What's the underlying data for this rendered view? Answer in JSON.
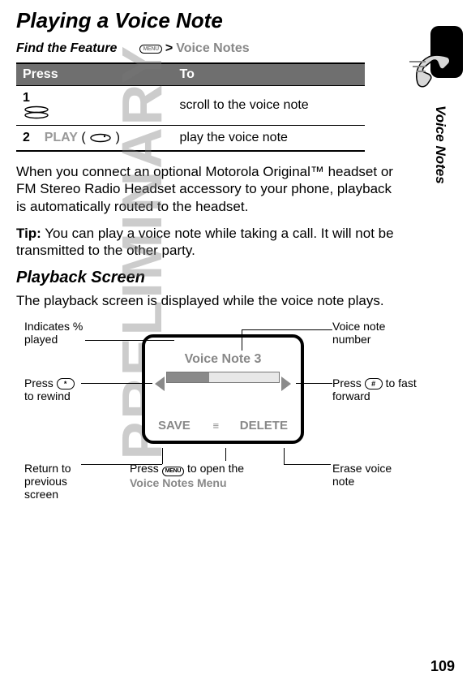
{
  "title": "Playing a Voice Note",
  "find_feature_label": "Find the Feature",
  "menu_key_label": "MENU",
  "nav_path": "Voice Notes",
  "side_tab": "Voice Notes",
  "watermark": "PRELIMINARY",
  "page_number": "109",
  "table": {
    "headers": {
      "press": "Press",
      "to": "To"
    },
    "rows": [
      {
        "num": "1",
        "press_label": "",
        "action": "scroll to the voice note"
      },
      {
        "num": "2",
        "press_label": "PLAY",
        "press_paren": "(        )",
        "action": "play the voice note"
      }
    ]
  },
  "body1": "When you connect an optional Motorola Original™ headset or FM Stereo Radio Headset accessory to your phone, playback is automatically routed to the headset.",
  "tip_label": "Tip:",
  "tip_text": " You can play a voice note while taking a call. It will not be transmitted to the other party.",
  "subheading": "Playback Screen",
  "body2": "The playback screen is displayed while the voice note plays.",
  "diagram": {
    "screen_title": "Voice Note 3",
    "save": "SAVE",
    "delete": "DELETE",
    "callouts": {
      "percent": "Indicates % played",
      "vn_number": "Voice note number",
      "rewind_a": "Press ",
      "rewind_b": " to rewind",
      "ff_a": "Press ",
      "ff_b": " to fast forward",
      "return": "Return to previous screen",
      "open_menu_a": "Press ",
      "open_menu_b": " to open the ",
      "open_menu_c": "Voice Notes Menu",
      "erase": "Erase voice note"
    },
    "keys": {
      "star": "*",
      "pound": "#"
    }
  }
}
